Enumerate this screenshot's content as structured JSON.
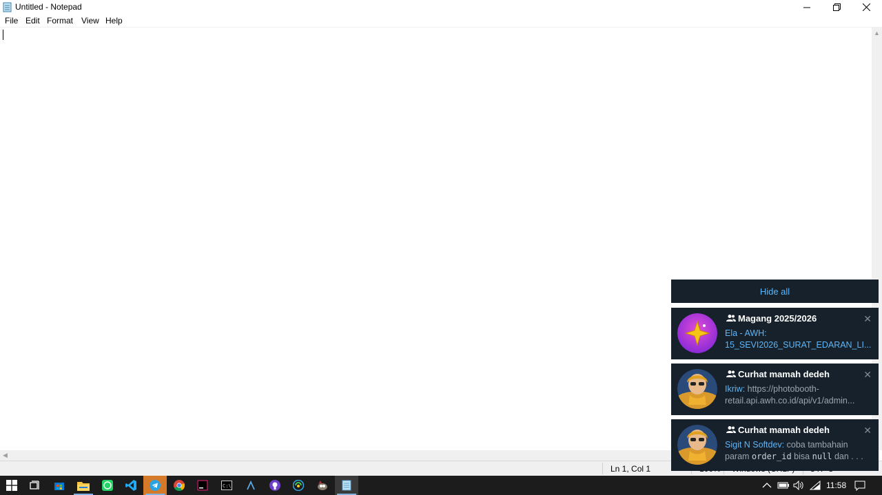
{
  "window": {
    "title": "Untitled - Notepad",
    "minimize_glyph": "─",
    "restore_glyph": "❐",
    "close_glyph": "✕"
  },
  "menu": {
    "items": [
      {
        "label": "File"
      },
      {
        "label": "Edit"
      },
      {
        "label": "Format"
      },
      {
        "label": "View"
      },
      {
        "label": "Help"
      }
    ]
  },
  "editor": {
    "content": ""
  },
  "statusbar": {
    "position": "Ln 1, Col 1",
    "zoom": "100%",
    "line_ending": "Windows (CRLF)",
    "encoding": "UTF-8"
  },
  "notifications": {
    "hide_all_label": "Hide all",
    "items": [
      {
        "group": "Magang 2025/2026",
        "sender": "Ela - AWH:",
        "line2": "15_SEVI2026_SURAT_EDARAN_LI...",
        "avatar": "star-avatar"
      },
      {
        "group": "Curhat mamah dedeh",
        "sender": "Ikriw:",
        "line1_rest": " https://photobooth-",
        "line2": "retail.api.awh.co.id/api/v1/admin...",
        "avatar": "person-avatar"
      },
      {
        "group": "Curhat mamah dedeh",
        "sender": "Sigit N Softdev:",
        "line1_rest": " coba tambahain",
        "line2_a": "param ",
        "line2_code1": "order_id",
        "line2_b": " bisa ",
        "line2_code2": "null",
        "line2_c": " dan . . .",
        "avatar": "person-avatar"
      }
    ]
  },
  "taskbar": {
    "clock": "11:58",
    "apps": [
      "start",
      "task-view",
      "store",
      "file-explorer",
      "whatsapp",
      "vscode",
      "telegram",
      "chrome",
      "jetbrains",
      "terminal",
      "arduino",
      "github-desktop",
      "browser",
      "gimp",
      "notepad"
    ]
  },
  "colors": {
    "notif_bg": "#17212b",
    "accent_blue": "#5eb5f7",
    "taskbar_bg": "#1c1c1c"
  }
}
